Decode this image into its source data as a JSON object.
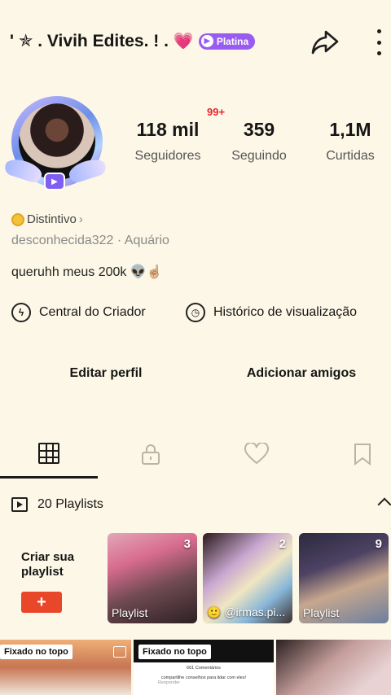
{
  "header": {
    "display_name": "' ✯ . Vivih Edites. ! .",
    "heart": "💗",
    "tier_badge": "Platina"
  },
  "notifications": {
    "badge": "99+"
  },
  "stats": [
    {
      "value": "118 mil",
      "label": "Seguidores"
    },
    {
      "value": "359",
      "label": "Seguindo"
    },
    {
      "value": "1,1M",
      "label": "Curtidas"
    }
  ],
  "profile": {
    "distintivo": "Distintivo",
    "handle": "desconhecida322",
    "sign": "Aquário",
    "bio": "queruhh meus 200k 👽☝🏼"
  },
  "links": {
    "creator_center": "Central do Criador",
    "watch_history": "Histórico de visualização"
  },
  "actions": {
    "edit_profile": "Editar perfil",
    "add_friends": "Adicionar amigos"
  },
  "playlists": {
    "header": "20 Playlists",
    "create_label": "Criar sua playlist",
    "create_button": "+",
    "items": [
      {
        "count": "3",
        "title": "Playlist"
      },
      {
        "count": "2",
        "title": "🙂 @irmas.pi..."
      },
      {
        "count": "9",
        "title": "Playlist"
      }
    ]
  },
  "videos": {
    "pinned_label": "Fixado no topo",
    "comments_count": "661 Comentários",
    "comment_text": "compartilhe conselhos para lidar com eles!",
    "reply_label": "Responder"
  }
}
